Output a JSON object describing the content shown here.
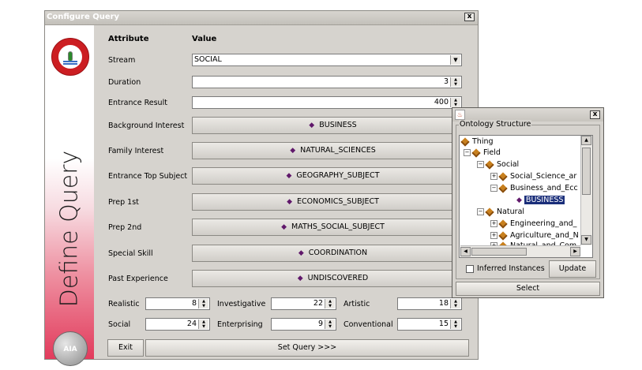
{
  "window": {
    "title": "Configure Query",
    "close_label": "x"
  },
  "banner": {
    "vertical_title": "Define Query",
    "bottom_logo_text": "AIA"
  },
  "headers": {
    "attribute": "Attribute",
    "value": "Value"
  },
  "rows": {
    "stream": {
      "label": "Stream",
      "value": "SOCIAL"
    },
    "duration": {
      "label": "Duration",
      "value": "3"
    },
    "entrance_result": {
      "label": "Entrance Result",
      "value": "400"
    },
    "background_interest": {
      "label": "Background Interest",
      "value": "BUSINESS"
    },
    "family_interest": {
      "label": "Family Interest",
      "value": "NATURAL_SCIENCES"
    },
    "entrance_top_subject": {
      "label": "Entrance Top Subject",
      "value": "GEOGRAPHY_SUBJECT"
    },
    "prep_1st": {
      "label": "Prep 1st",
      "value": "ECONOMICS_SUBJECT"
    },
    "prep_2nd": {
      "label": "Prep 2nd",
      "value": "MATHS_SOCIAL_SUBJECT"
    },
    "special_skill": {
      "label": "Special Skill",
      "value": "COORDINATION"
    },
    "past_experience": {
      "label": "Past Experience",
      "value": "UNDISCOVERED"
    }
  },
  "riasec": {
    "realistic": {
      "label": "Realistic",
      "value": "8"
    },
    "investigative": {
      "label": "Investigative",
      "value": "22"
    },
    "artistic": {
      "label": "Artistic",
      "value": "18"
    },
    "social": {
      "label": "Social",
      "value": "24"
    },
    "enterprising": {
      "label": "Enterprising",
      "value": "9"
    },
    "conventional": {
      "label": "Conventional",
      "value": "15"
    }
  },
  "buttons": {
    "exit": "Exit",
    "set_query": "Set Query >>>"
  },
  "popup": {
    "close_label": "x",
    "legend": "Ontology Structure",
    "tree": {
      "thing": "Thing",
      "field": "Field",
      "social": "Social",
      "social_science": "Social_Science_ar",
      "business_eco": "Business_and_Ecc",
      "business": "BUSINESS",
      "natural": "Natural",
      "engineering": "Engineering_and_",
      "agriculture": "Agriculture_and_N",
      "natural_and": "Natural_and_Com"
    },
    "inferred_label": "Inferred Instances",
    "inferred_checked": false,
    "update_label": "Update",
    "select_label": "Select"
  },
  "colors": {
    "accent_purple": "#60186b",
    "selection": "#1a2e7a",
    "banner_red": "#e23b5c"
  }
}
